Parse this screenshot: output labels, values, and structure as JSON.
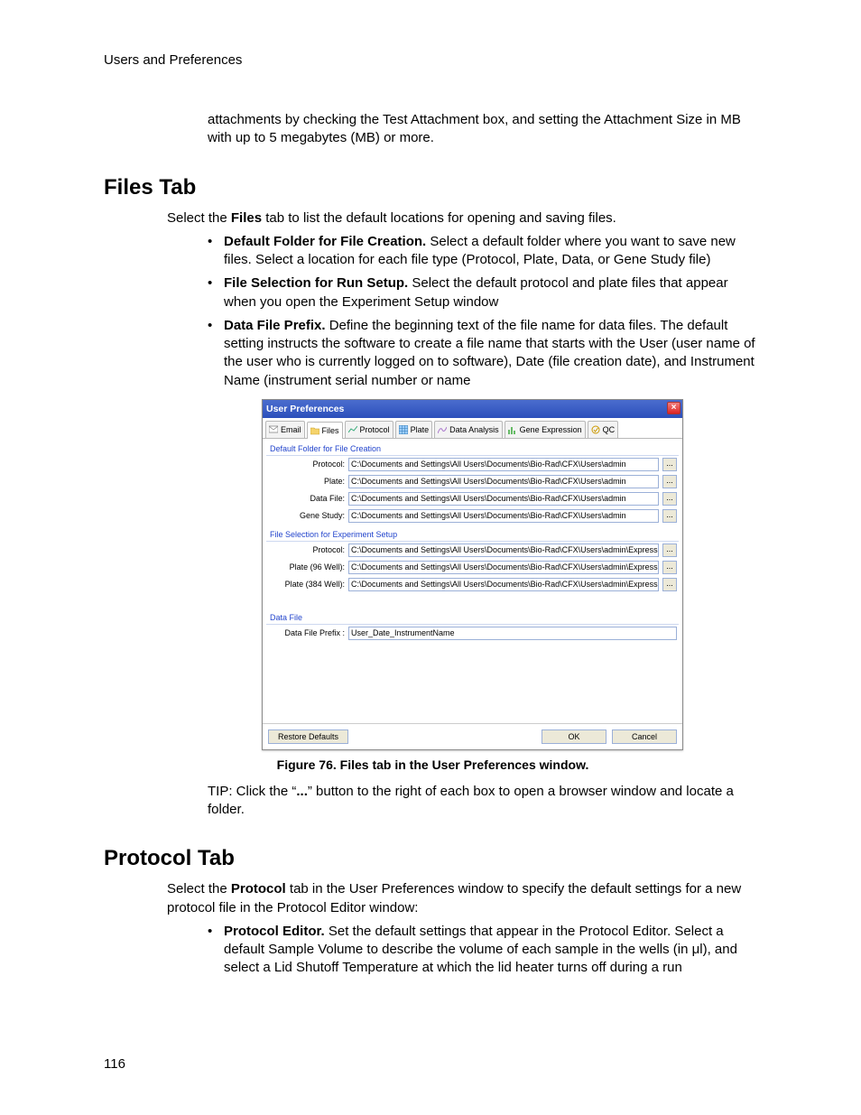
{
  "header": "Users and Preferences",
  "lead_paragraph": "attachments by checking the Test Attachment box, and setting the Attachment Size in MB with up to 5 megabytes (MB) or more.",
  "files_heading": "Files Tab",
  "files_intro_1": "Select the ",
  "files_intro_bold": "Files",
  "files_intro_2": " tab to list the default locations for opening and saving files.",
  "files_bullets": [
    {
      "lead": "Default Folder for File Creation.",
      "rest": " Select a default folder where you want to save new files. Select a location for each file type (Protocol, Plate, Data, or Gene Study file)"
    },
    {
      "lead": "File Selection for Run Setup.",
      "rest": " Select the default protocol and plate files that appear when you open the Experiment Setup window"
    },
    {
      "lead": "Data File Prefix.",
      "rest": " Define the beginning text of the file name for data files. The default setting instructs the software to create a file name that starts with the User (user name of the user who is currently logged on to software), Date (file creation date), and Instrument Name (instrument serial number or name"
    }
  ],
  "window": {
    "title": "User Preferences",
    "tabs": [
      "Email",
      "Files",
      "Protocol",
      "Plate",
      "Data Analysis",
      "Gene Expression",
      "QC"
    ],
    "section1": "Default Folder for File Creation",
    "s1_rows": [
      {
        "label": "Protocol:",
        "value": "C:\\Documents and Settings\\All Users\\Documents\\Bio-Rad\\CFX\\Users\\admin"
      },
      {
        "label": "Plate:",
        "value": "C:\\Documents and Settings\\All Users\\Documents\\Bio-Rad\\CFX\\Users\\admin"
      },
      {
        "label": "Data File:",
        "value": "C:\\Documents and Settings\\All Users\\Documents\\Bio-Rad\\CFX\\Users\\admin"
      },
      {
        "label": "Gene Study:",
        "value": "C:\\Documents and Settings\\All Users\\Documents\\Bio-Rad\\CFX\\Users\\admin"
      }
    ],
    "section2": "File Selection for Experiment Setup",
    "s2_rows": [
      {
        "label": "Protocol:",
        "value": "C:\\Documents and Settings\\All Users\\Documents\\Bio-Rad\\CFX\\Users\\admin\\ExpressLoad\\"
      },
      {
        "label": "Plate (96 Well):",
        "value": "C:\\Documents and Settings\\All Users\\Documents\\Bio-Rad\\CFX\\Users\\admin\\ExpressLoad\\"
      },
      {
        "label": "Plate (384 Well):",
        "value": "C:\\Documents and Settings\\All Users\\Documents\\Bio-Rad\\CFX\\Users\\admin\\ExpressLoad\\"
      }
    ],
    "section3": "Data File",
    "prefix_label": "Data File Prefix :",
    "prefix_value": "User_Date_InstrumentName",
    "restore": "Restore Defaults",
    "ok": "OK",
    "cancel": "Cancel",
    "ellipsis": "..."
  },
  "caption": "Figure 76. Files tab in the User Preferences window.",
  "tip_1": "TIP: Click the “",
  "tip_bold": "...",
  "tip_2": "” button to the right of each box to open a browser window and locate a folder.",
  "protocol_heading": "Protocol Tab",
  "protocol_intro_1": "Select the ",
  "protocol_intro_bold": "Protocol",
  "protocol_intro_2": " tab in the User Preferences window to specify the default settings for a new protocol file in the Protocol Editor window:",
  "protocol_bullets": [
    {
      "lead": "Protocol Editor.",
      "rest": " Set the default settings that appear in the Protocol Editor. Select a default Sample Volume to describe the volume of each sample in the wells (in μl), and select a Lid Shutoff Temperature at which the lid heater turns off during a run"
    }
  ],
  "page_number": "116"
}
